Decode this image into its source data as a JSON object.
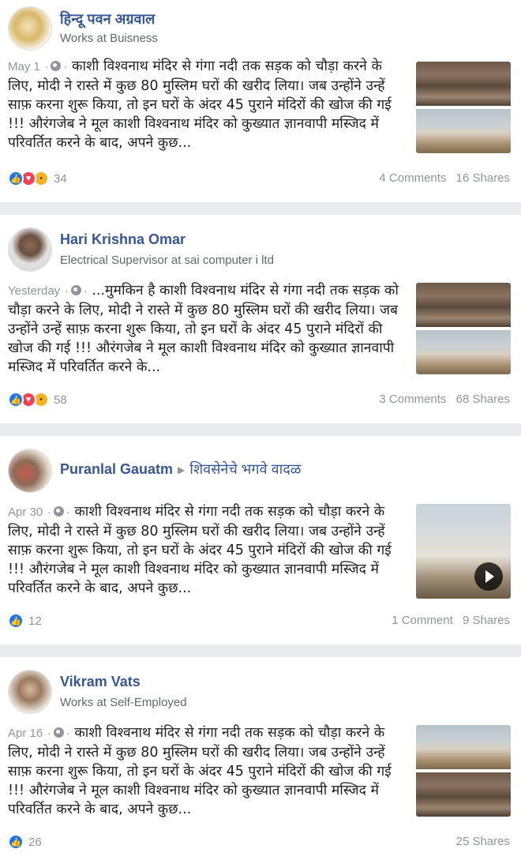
{
  "posts": [
    {
      "author": "हिन्दू पवन अग्रवाल",
      "subtitle": "Works at Buisness",
      "date": "May 1",
      "text": "काशी विश्वनाथ मंदिर से गंगा नदी तक सड़क को चौड़ा करने के लिए, मोदी ने रास्ते में कुछ 80 मुस्लिम घरों की खरीद लिया। जब उन्होंने उन्हें साफ़ करना शुरू किया, तो इन घरों के अंदर 45 पुराने मंदिरों की खोज की गई !!! औरंगजेब ने मूल काशी विश्वनाथ मंदिर को कुख्यात ज्ञानवापी मस्जिद में परिवर्तित करने के बाद, अपने कुछ...",
      "reaction_count": "34",
      "comments": "4 Comments",
      "shares": "16 Shares"
    },
    {
      "author": "Hari Krishna Omar",
      "subtitle": "Electrical Supervisor at sai computer i ltd",
      "date": "Yesterday",
      "text": "...मुमकिन है काशी विश्वनाथ मंदिर से गंगा नदी तक सड़क को चौड़ा करने के लिए, मोदी ने रास्ते में कुछ 80 मुस्लिम घरों की खरीद लिया। जब उन्होंने उन्हें साफ़ करना शुरू किया, तो इन घरों के अंदर 45 पुराने मंदिरों की खोज की गई !!! औरंगजेब ने मूल काशी विश्वनाथ मंदिर को कुख्यात ज्ञानवापी मस्जिद में परिवर्तित करने के...",
      "reaction_count": "58",
      "comments": "3 Comments",
      "shares": "68 Shares"
    },
    {
      "author": "Puranlal Gauatm",
      "group": "शिवसेनेचे भगवे वादळ",
      "date": "Apr 30",
      "text": "काशी विश्वनाथ मंदिर से गंगा नदी तक सड़क को चौड़ा करने के लिए, मोदी ने रास्ते में कुछ 80 मुस्लिम घरों की खरीद लिया। जब उन्होंने उन्हें साफ़ करना शुरू किया, तो इन घरों के अंदर 45 पुराने मंदिरों की खोज की गई !!! औरंगजेब ने मूल काशी विश्वनाथ मंदिर को कुख्यात ज्ञानवापी मस्जिद में परिवर्तित करने के बाद, अपने कुछ...",
      "reaction_count": "12",
      "comments": "1 Comment",
      "shares": "9 Shares"
    },
    {
      "author": "Vikram Vats",
      "subtitle": "Works at Self-Employed",
      "date": "Apr 16",
      "text": "काशी विश्वनाथ मंदिर से गंगा नदी तक सड़क को चौड़ा करने के लिए, मोदी ने रास्ते में कुछ 80 मुस्लिम घरों की खरीद लिया। जब उन्होंने उन्हें साफ़ करना शुरू किया, तो इन घरों के अंदर 45 पुराने मंदिरों की खोज की गई !!! औरंगजेब ने मूल काशी विश्वनाथ मंदिर को कुख्यात ज्ञानवापी मस्जिद में परिवर्तित करने के बाद, अपने कुछ...",
      "reaction_count": "26",
      "shares": "25 Shares"
    }
  ],
  "icons": {
    "like": "thumbs-up-icon",
    "love": "heart-icon",
    "wow": "wow-face-icon",
    "privacy": "globe-icon",
    "play": "play-icon"
  },
  "colors": {
    "link": "#365899",
    "meta": "#90949c",
    "separator": "#e9ebee"
  }
}
